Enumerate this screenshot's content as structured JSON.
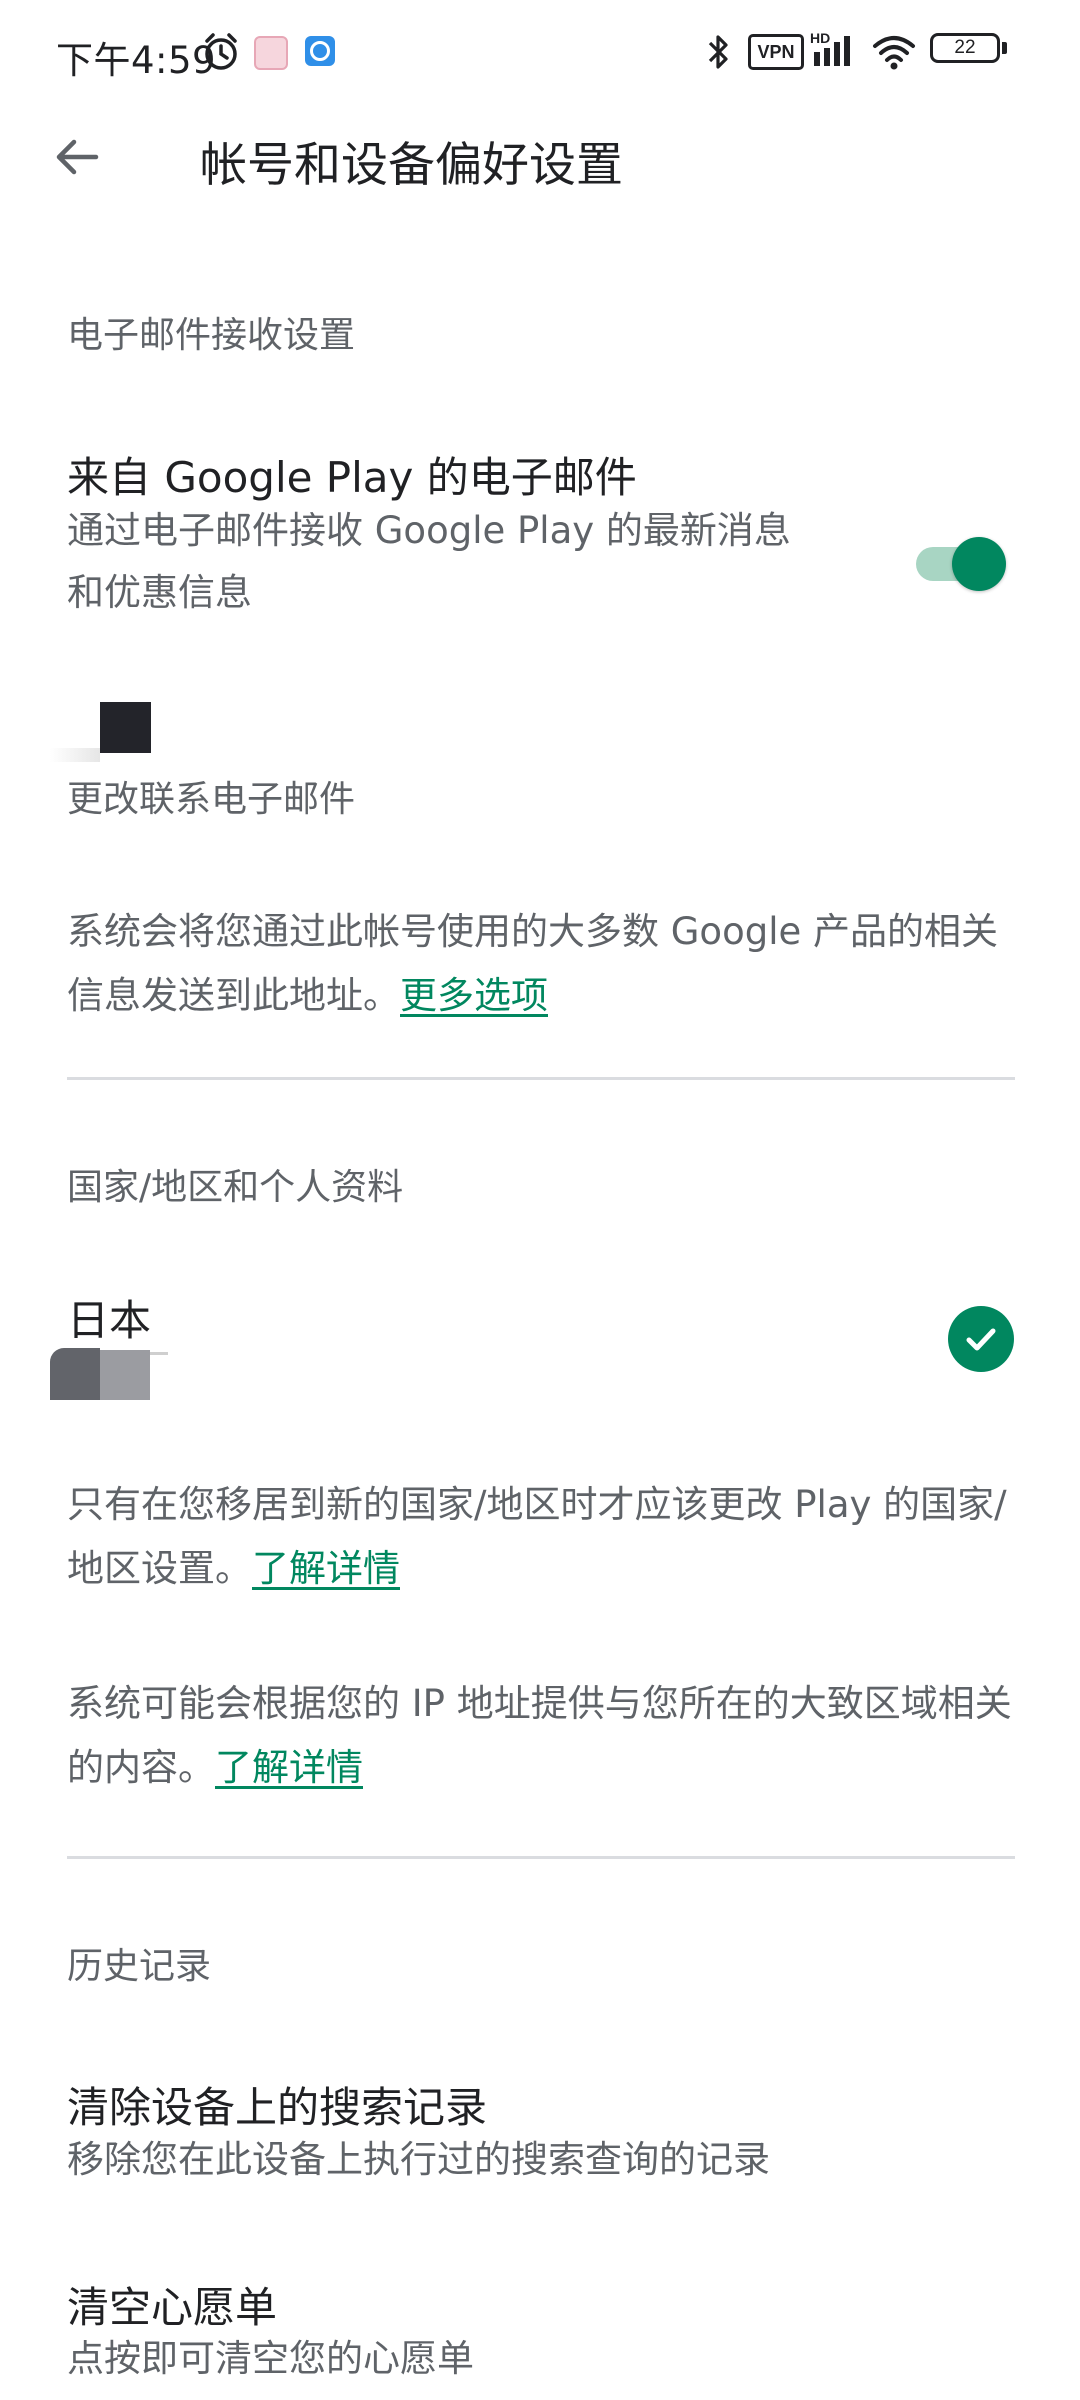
{
  "status_bar": {
    "time": "下午4:59",
    "icons": [
      "alarm-icon",
      "app-notification-icon",
      "app-notification-icon-2",
      "bluetooth-icon",
      "vpn-icon",
      "signal-icon",
      "wifi-icon",
      "battery-icon"
    ],
    "vpn_label": "VPN",
    "hd_label": "HD",
    "battery_level": "22"
  },
  "header": {
    "title": "帐号和设备偏好设置",
    "back_icon": "arrow-back-icon"
  },
  "email_section": {
    "header": "电子邮件接收设置",
    "google_play_email": {
      "title": "来自 Google Play 的电子邮件",
      "subtitle_line1": "通过电子邮件接收 Google Play 的最新消息",
      "subtitle_line2": "和优惠信息",
      "toggle_on": true
    },
    "change_email_label": "更改联系电子邮件",
    "info_text": "系统会将您通过此帐号使用的大多数 Google 产品的相关信息发送到此地址。",
    "info_link": "更多选项"
  },
  "country_section": {
    "header": "国家/地区和个人资料",
    "country": "日本",
    "selected": true,
    "note1_text": "只有在您移居到新的国家/地区时才应该更改 Play 的国家/地区设置。",
    "note1_link": "了解详情",
    "note2_text": "系统可能会根据您的 IP 地址提供与您所在的大致区域相关的内容。",
    "note2_link": "了解详情"
  },
  "history_section": {
    "header": "历史记录",
    "clear_search": {
      "title": "清除设备上的搜索记录",
      "subtitle": "移除您在此设备上执行过的搜索查询的记录"
    },
    "clear_wishlist": {
      "title": "清空心愿单",
      "subtitle": "点按即可清空您的心愿单"
    }
  },
  "colors": {
    "accent": "#01875f",
    "toggle_track": "#a8d5c3",
    "secondary_text": "#5f6368",
    "divider": "#dadce0"
  }
}
